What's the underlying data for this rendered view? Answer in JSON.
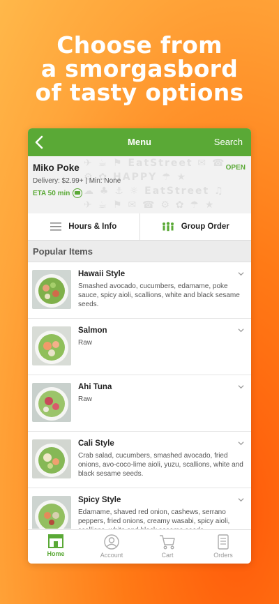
{
  "headline": [
    "Choose from",
    "a smorgasbord",
    "of tasty options"
  ],
  "nav": {
    "back_icon": "chevron-left-icon",
    "title": "Menu",
    "search_label": "Search"
  },
  "restaurant": {
    "name": "Miko Poke",
    "status": "OPEN",
    "delivery_info": "Delivery: $2.99+ | Min: None",
    "eta": "ETA 50 min",
    "eta_icon": "car-icon",
    "background_text": [
      "HAPPY",
      "EatStreet"
    ]
  },
  "actions": [
    {
      "label": "Hours & Info",
      "icon": "list-icon"
    },
    {
      "label": "Group Order",
      "icon": "group-icon"
    }
  ],
  "section_title": "Popular Items",
  "items": [
    {
      "name": "Hawaii Style",
      "desc": "Smashed avocado, cucumbers, edamame, poke sauce, spicy aioli, scallions, white and black sesame seeds."
    },
    {
      "name": "Salmon",
      "desc": "Raw"
    },
    {
      "name": "Ahi Tuna",
      "desc": "Raw"
    },
    {
      "name": "Cali Style",
      "desc": "Crab salad, cucumbers, smashed avocado, fried onions, avo-coco-lime aioli, yuzu, scallions, white and black sesame seeds."
    },
    {
      "name": "Spicy Style",
      "desc": "Edamame, shaved red onion, cashews, serrano peppers, fried onions, creamy wasabi, spicy aioli, scallions, white and black sesame seeds."
    }
  ],
  "tabs": [
    {
      "label": "Home",
      "icon": "storefront-icon",
      "active": true
    },
    {
      "label": "Account",
      "icon": "user-icon",
      "active": false
    },
    {
      "label": "Cart",
      "icon": "cart-icon",
      "active": false
    },
    {
      "label": "Orders",
      "icon": "receipt-icon",
      "active": false
    }
  ],
  "colors": {
    "accent": "#5aa936",
    "background": "#ff7a16"
  }
}
